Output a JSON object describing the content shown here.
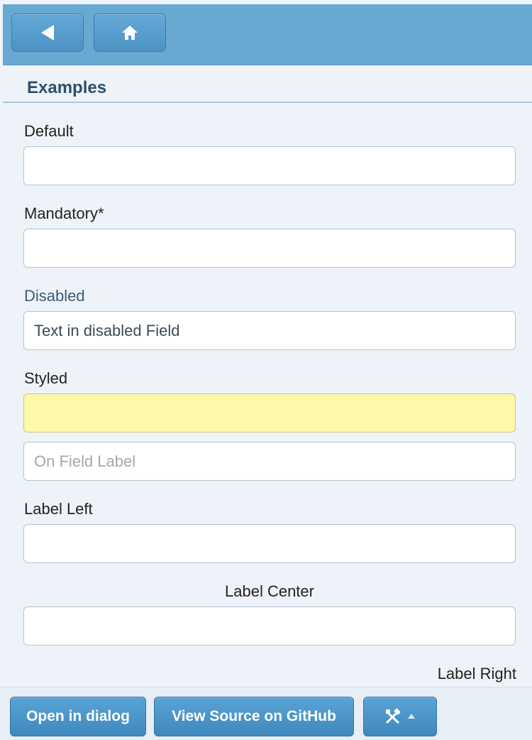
{
  "header": {
    "back_icon": "back-arrow-icon",
    "home_icon": "home-icon"
  },
  "section": {
    "title": "Examples"
  },
  "fields": {
    "default": {
      "label": "Default",
      "value": ""
    },
    "mandatory": {
      "label": "Mandatory*",
      "value": ""
    },
    "disabled": {
      "label": "Disabled",
      "value": "Text in disabled Field"
    },
    "styled": {
      "label": "Styled",
      "value": "",
      "background": "#fdf9a8"
    },
    "on_field": {
      "placeholder": "On Field Label",
      "value": ""
    },
    "label_left": {
      "label": "Label Left",
      "value": ""
    },
    "label_center": {
      "label": "Label Center",
      "value": ""
    },
    "label_right": {
      "label": "Label Right"
    }
  },
  "footer": {
    "open_dialog_label": "Open in dialog",
    "github_label": "View Source on GitHub",
    "tools_icon": "tools-icon",
    "caret_icon": "caret-up-icon"
  },
  "colors": {
    "header": "#68a9d2",
    "button": "#4c92c3",
    "title": "#2e4f69"
  }
}
